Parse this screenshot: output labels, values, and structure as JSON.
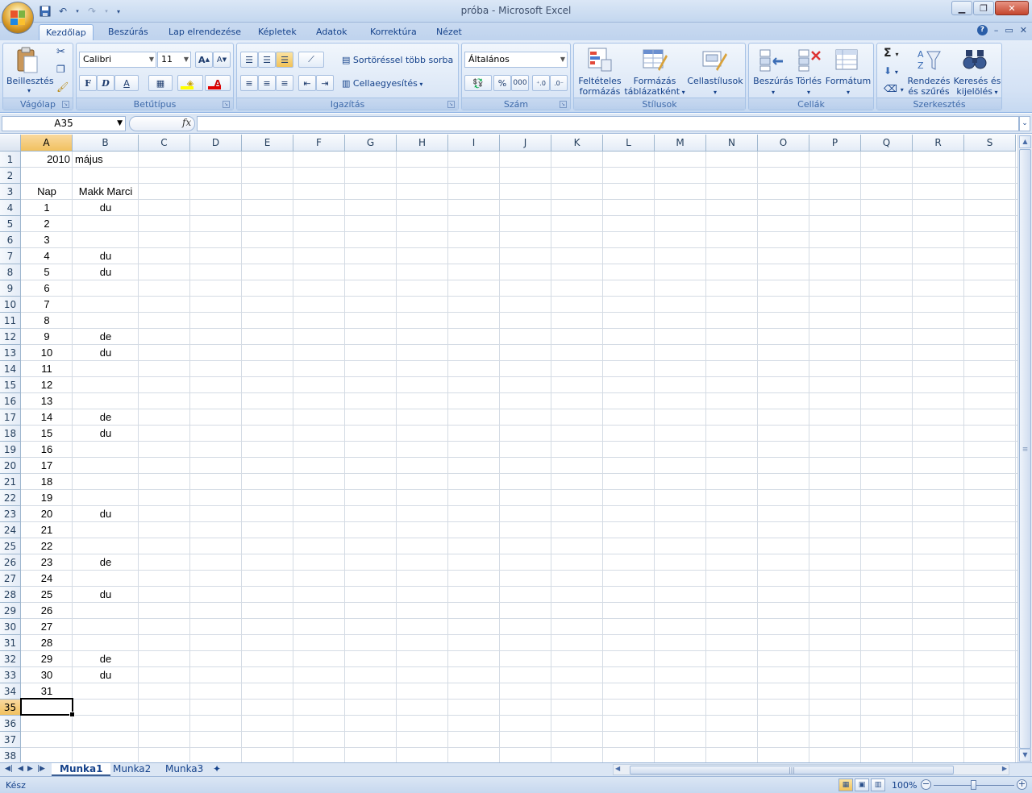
{
  "window": {
    "title": "próba - Microsoft Excel"
  },
  "tabs": [
    "Kezdőlap",
    "Beszúrás",
    "Lap elrendezése",
    "Képletek",
    "Adatok",
    "Korrektúra",
    "Nézet"
  ],
  "ribbon": {
    "clipboard": {
      "label": "Vágólap",
      "paste": "Beillesztés"
    },
    "font": {
      "label": "Betűtípus",
      "name": "Calibri",
      "size": "11",
      "bold": "F",
      "italic": "D",
      "underline": "A"
    },
    "alignment": {
      "label": "Igazítás",
      "wrap": "Sortöréssel több sorba",
      "merge": "Cellaegyesítés"
    },
    "number": {
      "label": "Szám",
      "format": "Általános",
      "percent": "%",
      "thousands": "000"
    },
    "styles": {
      "label": "Stílusok",
      "conditional_1": "Feltételes",
      "conditional_2": "formázás",
      "table_1": "Formázás",
      "table_2": "táblázatként",
      "cell_styles": "Cellastílusok"
    },
    "cells": {
      "label": "Cellák",
      "insert": "Beszúrás",
      "delete": "Törlés",
      "format": "Formátum"
    },
    "editing": {
      "label": "Szerkesztés",
      "sort_1": "Rendezés",
      "sort_2": "és szűrés",
      "find_1": "Keresés és",
      "find_2": "kijelölés"
    }
  },
  "formula_bar": {
    "name_box": "A35",
    "fx": "fx",
    "formula": ""
  },
  "columns": [
    "A",
    "B",
    "C",
    "D",
    "E",
    "F",
    "G",
    "H",
    "I",
    "J",
    "K",
    "L",
    "M",
    "N",
    "O",
    "P",
    "Q",
    "R",
    "S"
  ],
  "rows": [
    "1",
    "2",
    "3",
    "4",
    "5",
    "6",
    "7",
    "8",
    "9",
    "10",
    "11",
    "12",
    "13",
    "14",
    "15",
    "16",
    "17",
    "18",
    "19",
    "20",
    "21",
    "22",
    "23",
    "24",
    "25",
    "26",
    "27",
    "28",
    "29",
    "30",
    "31",
    "32",
    "33",
    "34",
    "35",
    "36",
    "37",
    "38"
  ],
  "selected": {
    "column": "A",
    "row": "35"
  },
  "cells": [
    {
      "row": 1,
      "col": "A",
      "value": "2010",
      "align": "num"
    },
    {
      "row": 1,
      "col": "B",
      "value": "május",
      "align": "left"
    },
    {
      "row": 3,
      "col": "A",
      "value": "Nap",
      "align": "ctr"
    },
    {
      "row": 3,
      "col": "B",
      "value": "Makk Marci",
      "align": "ctr"
    },
    {
      "row": 4,
      "col": "A",
      "value": "1",
      "align": "ctr"
    },
    {
      "row": 4,
      "col": "B",
      "value": "du",
      "align": "ctr"
    },
    {
      "row": 5,
      "col": "A",
      "value": "2",
      "align": "ctr"
    },
    {
      "row": 6,
      "col": "A",
      "value": "3",
      "align": "ctr"
    },
    {
      "row": 7,
      "col": "A",
      "value": "4",
      "align": "ctr"
    },
    {
      "row": 7,
      "col": "B",
      "value": "du",
      "align": "ctr"
    },
    {
      "row": 8,
      "col": "A",
      "value": "5",
      "align": "ctr"
    },
    {
      "row": 8,
      "col": "B",
      "value": "du",
      "align": "ctr"
    },
    {
      "row": 9,
      "col": "A",
      "value": "6",
      "align": "ctr"
    },
    {
      "row": 10,
      "col": "A",
      "value": "7",
      "align": "ctr"
    },
    {
      "row": 11,
      "col": "A",
      "value": "8",
      "align": "ctr"
    },
    {
      "row": 12,
      "col": "A",
      "value": "9",
      "align": "ctr"
    },
    {
      "row": 12,
      "col": "B",
      "value": "de",
      "align": "ctr"
    },
    {
      "row": 13,
      "col": "A",
      "value": "10",
      "align": "ctr"
    },
    {
      "row": 13,
      "col": "B",
      "value": "du",
      "align": "ctr"
    },
    {
      "row": 14,
      "col": "A",
      "value": "11",
      "align": "ctr"
    },
    {
      "row": 15,
      "col": "A",
      "value": "12",
      "align": "ctr"
    },
    {
      "row": 16,
      "col": "A",
      "value": "13",
      "align": "ctr"
    },
    {
      "row": 17,
      "col": "A",
      "value": "14",
      "align": "ctr"
    },
    {
      "row": 17,
      "col": "B",
      "value": "de",
      "align": "ctr"
    },
    {
      "row": 18,
      "col": "A",
      "value": "15",
      "align": "ctr"
    },
    {
      "row": 18,
      "col": "B",
      "value": "du",
      "align": "ctr"
    },
    {
      "row": 19,
      "col": "A",
      "value": "16",
      "align": "ctr"
    },
    {
      "row": 20,
      "col": "A",
      "value": "17",
      "align": "ctr"
    },
    {
      "row": 21,
      "col": "A",
      "value": "18",
      "align": "ctr"
    },
    {
      "row": 22,
      "col": "A",
      "value": "19",
      "align": "ctr"
    },
    {
      "row": 23,
      "col": "A",
      "value": "20",
      "align": "ctr"
    },
    {
      "row": 23,
      "col": "B",
      "value": "du",
      "align": "ctr"
    },
    {
      "row": 24,
      "col": "A",
      "value": "21",
      "align": "ctr"
    },
    {
      "row": 25,
      "col": "A",
      "value": "22",
      "align": "ctr"
    },
    {
      "row": 26,
      "col": "A",
      "value": "23",
      "align": "ctr"
    },
    {
      "row": 26,
      "col": "B",
      "value": "de",
      "align": "ctr"
    },
    {
      "row": 27,
      "col": "A",
      "value": "24",
      "align": "ctr"
    },
    {
      "row": 28,
      "col": "A",
      "value": "25",
      "align": "ctr"
    },
    {
      "row": 28,
      "col": "B",
      "value": "du",
      "align": "ctr"
    },
    {
      "row": 29,
      "col": "A",
      "value": "26",
      "align": "ctr"
    },
    {
      "row": 30,
      "col": "A",
      "value": "27",
      "align": "ctr"
    },
    {
      "row": 31,
      "col": "A",
      "value": "28",
      "align": "ctr"
    },
    {
      "row": 32,
      "col": "A",
      "value": "29",
      "align": "ctr"
    },
    {
      "row": 32,
      "col": "B",
      "value": "de",
      "align": "ctr"
    },
    {
      "row": 33,
      "col": "A",
      "value": "30",
      "align": "ctr"
    },
    {
      "row": 33,
      "col": "B",
      "value": "du",
      "align": "ctr"
    },
    {
      "row": 34,
      "col": "A",
      "value": "31",
      "align": "ctr"
    }
  ],
  "sheets": [
    "Munka1",
    "Munka2",
    "Munka3"
  ],
  "active_sheet": "Munka1",
  "status": {
    "text": "Kész",
    "zoom": "100%"
  },
  "icons": {
    "save": "save-icon",
    "undo": "undo-icon",
    "redo": "redo-icon",
    "help": "help-icon"
  }
}
